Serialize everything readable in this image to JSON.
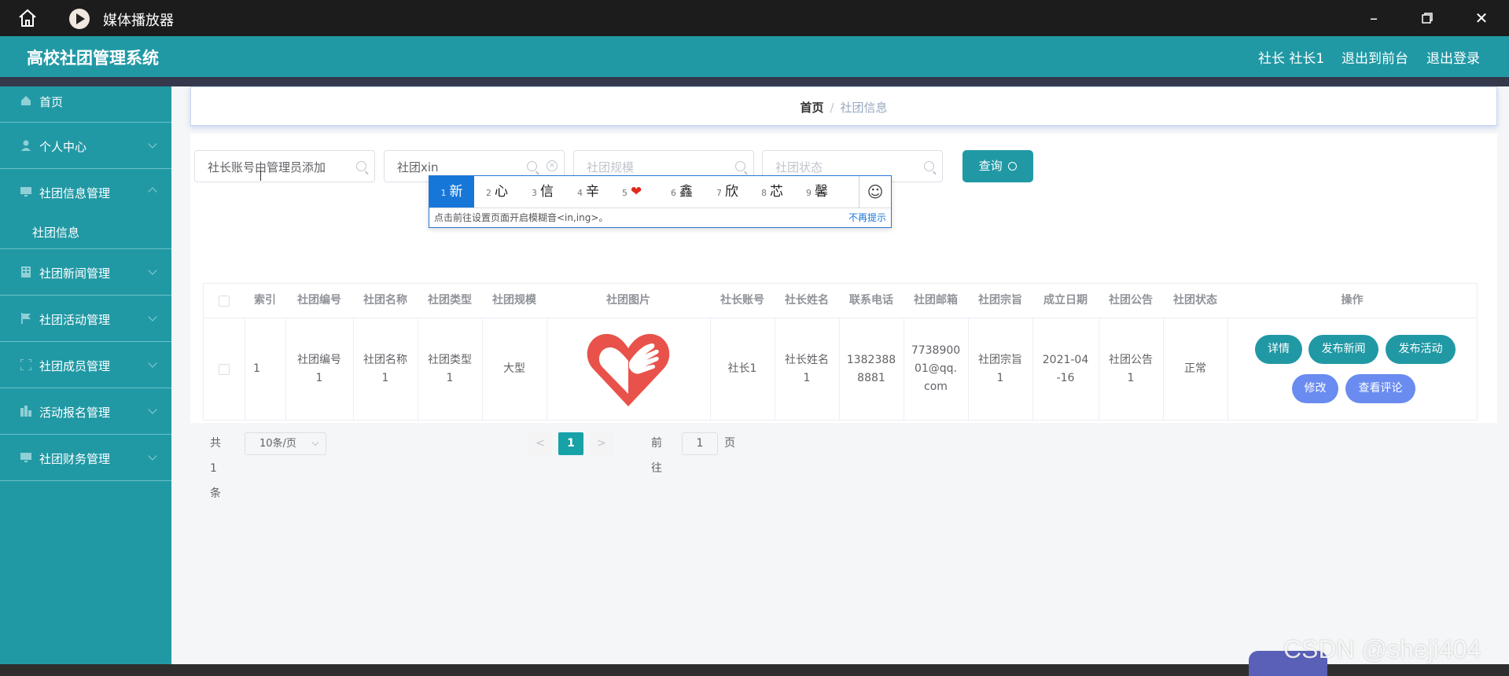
{
  "titlebar": {
    "app_title": "媒体播放器"
  },
  "header": {
    "system_title": "高校社团管理系统",
    "user_label": "社长 社长1",
    "to_front_label": "退出到前台",
    "logout_label": "退出登录"
  },
  "sidebar": {
    "items": [
      {
        "label": "首页",
        "icon": "home-icon"
      },
      {
        "label": "个人中心",
        "icon": "user-icon"
      },
      {
        "label": "社团信息管理",
        "icon": "monitor-icon"
      },
      {
        "label": "社团新闻管理",
        "icon": "building-icon"
      },
      {
        "label": "社团活动管理",
        "icon": "flag-icon"
      },
      {
        "label": "社团成员管理",
        "icon": "fullscreen-icon"
      },
      {
        "label": "活动报名管理",
        "icon": "chart-icon"
      },
      {
        "label": "社团财务管理",
        "icon": "monitor-icon"
      }
    ],
    "sub_item": "社团信息"
  },
  "breadcrumb": {
    "home": "首页",
    "separator": "/",
    "current": "社团信息"
  },
  "search": {
    "field1_value": "社长账号由管理员添加",
    "field2_value": "社团xin",
    "field3_placeholder": "社团规模",
    "field4_placeholder": "社团状态",
    "query_label": "查询"
  },
  "ime": {
    "candidates": [
      {
        "n": "1",
        "text": "新"
      },
      {
        "n": "2",
        "text": "心"
      },
      {
        "n": "3",
        "text": "信"
      },
      {
        "n": "4",
        "text": "辛"
      },
      {
        "n": "5",
        "text": "❤"
      },
      {
        "n": "6",
        "text": "鑫"
      },
      {
        "n": "7",
        "text": "欣"
      },
      {
        "n": "8",
        "text": "芯"
      },
      {
        "n": "9",
        "text": "馨"
      }
    ],
    "emoji": "☺",
    "tip": "点击前往设置页面开启模糊音<in,ing>。",
    "no_tip": "不再提示"
  },
  "table": {
    "headers": [
      "索引",
      "社团编号",
      "社团名称",
      "社团类型",
      "社团规模",
      "社团图片",
      "社长账号",
      "社长姓名",
      "联系电话",
      "社团邮箱",
      "社团宗旨",
      "成立日期",
      "社团公告",
      "社团状态",
      "操作"
    ],
    "row": {
      "index": "1",
      "club_no_1": "社团编号",
      "club_no_2": "1",
      "club_name_1": "社团名称",
      "club_name_2": "1",
      "club_type_1": "社团类型",
      "club_type_2": "1",
      "scale": "大型",
      "leader_account": "社长1",
      "leader_name_1": "社长姓名",
      "leader_name_2": "1",
      "phone_1": "1382388",
      "phone_2": "8881",
      "email_1": "7738900",
      "email_2": "01@qq.",
      "email_3": "com",
      "purpose_1": "社团宗旨",
      "purpose_2": "1",
      "date_1": "2021-04",
      "date_2": "-16",
      "notice_1": "社团公告",
      "notice_2": "1",
      "status": "正常"
    },
    "actions": {
      "detail": "详情",
      "publish_news": "发布新闻",
      "publish_activity": "发布活动",
      "edit": "修改",
      "view_comments": "查看评论"
    }
  },
  "pagination": {
    "total": "共 1 条",
    "page_size": "10条/页",
    "prev": "<",
    "current": "1",
    "next": ">",
    "goto": "前往",
    "goto_value": "1",
    "unit": "页"
  },
  "watermark": "CSDN @sheji404",
  "colors": {
    "primary": "#2199a5",
    "accent_blue": "#6a8cf0",
    "ime_selected": "#1777d8",
    "dark_strip": "#34384a"
  }
}
